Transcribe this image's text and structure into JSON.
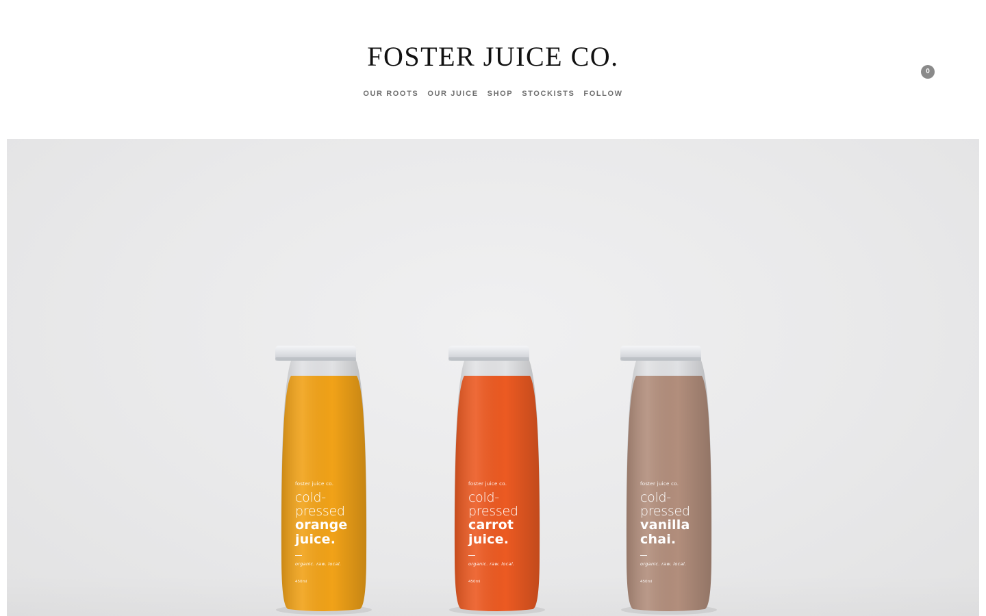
{
  "header": {
    "site_title": "FOSTER JUICE CO.",
    "cart_count": "0"
  },
  "nav": {
    "items": [
      {
        "label": "OUR ROOTS"
      },
      {
        "label": "OUR JUICE"
      },
      {
        "label": "SHOP"
      },
      {
        "label": "STOCKISTS"
      },
      {
        "label": "FOLLOW"
      }
    ]
  },
  "hero": {
    "bottles": [
      {
        "brand": "foster juice co.",
        "line1": "cold-",
        "line2": "pressed",
        "line3": "orange",
        "line4": "juice.",
        "tagline": "organic. raw. local.",
        "volume": "450ml",
        "juice_color": "#f1a218"
      },
      {
        "brand": "foster juice co.",
        "line1": "cold-",
        "line2": "pressed",
        "line3": "carrot",
        "line4": "juice.",
        "tagline": "organic. raw. local.",
        "volume": "450ml",
        "juice_color": "#ec5a22"
      },
      {
        "brand": "foster juice co.",
        "line1": "cold-",
        "line2": "pressed",
        "line3": "vanilla",
        "line4": "chai.",
        "tagline": "organic. raw. local.",
        "volume": "450ml",
        "juice_color": "#b28e7c"
      }
    ]
  },
  "colors": {
    "nav_text": "#6f6f6f",
    "title_text": "#111111",
    "cart_badge": "#8a8a8a",
    "hero_background": "#eaeaeb"
  }
}
